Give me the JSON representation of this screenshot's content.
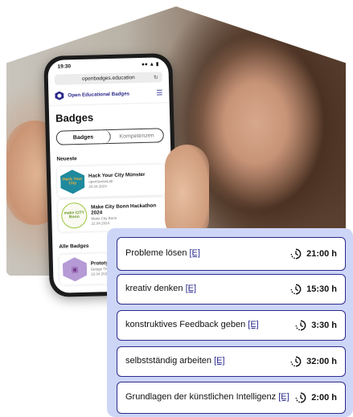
{
  "phone": {
    "status_time": "19:30",
    "status_icons": "●● ▲ ▮",
    "url": "openbadges.education",
    "brand": "Open Educational Badges",
    "page_title": "Badges",
    "tabs": [
      {
        "label": "Badges",
        "active": true
      },
      {
        "label": "Kompetenzen",
        "active": false
      }
    ],
    "section_recent": "Neueste",
    "recent_badges": [
      {
        "art": "Hack Your City",
        "title": "Hack Your City Münster",
        "issuer": "openSenseLab",
        "date": "20.04.2024"
      },
      {
        "art": "make CITY Bonn",
        "title": "Make City Bonn Hackathon 2024",
        "issuer": "Make City Bonn",
        "date": "22.04.2024"
      }
    ],
    "section_all": "Alle Badges",
    "all_badges": [
      {
        "title": "Prototy",
        "issuer": "Design Thi",
        "date": "22.04.202"
      }
    ]
  },
  "competencies": [
    {
      "label": "Probleme lösen",
      "link": "[E]",
      "hours": "21:00 h"
    },
    {
      "label": "kreativ denken",
      "link": "[E]",
      "hours": "15:30 h"
    },
    {
      "label": "konstruktives Feedback geben",
      "link": "[E]",
      "hours": "3:30 h"
    },
    {
      "label": "selbstständig arbeiten",
      "link": "[E]",
      "hours": "32:00 h"
    },
    {
      "label": "Grundlagen der künstlichen Intelligenz",
      "link": "[E]",
      "hours": "2:00 h"
    }
  ],
  "colors": {
    "accent": "#2b2a8c",
    "panel_bg": "#cdd6f6"
  }
}
